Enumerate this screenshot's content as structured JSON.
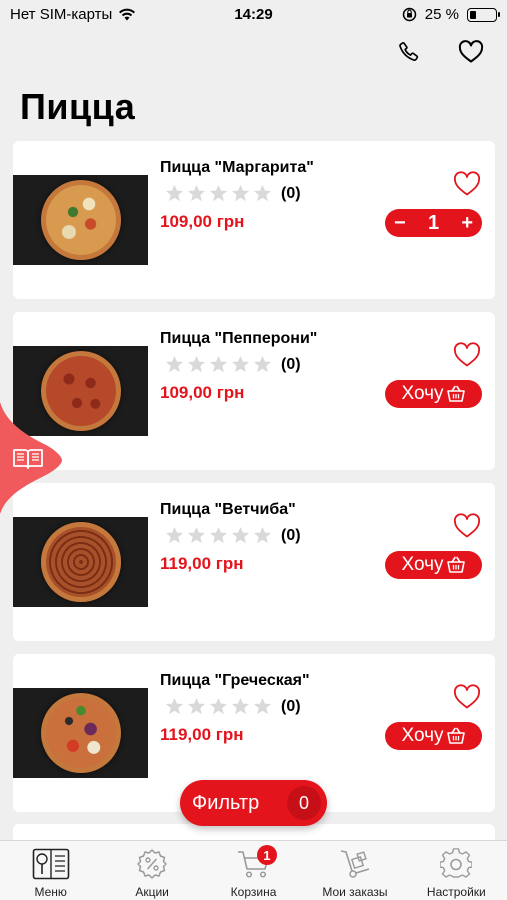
{
  "status_bar": {
    "carrier": "Нет SIM-карты",
    "time": "14:29",
    "battery_percent_text": "25 %",
    "battery_level": 0.25
  },
  "page": {
    "title": "Пицца"
  },
  "products": [
    {
      "name": "Пицца \"Маргарита\"",
      "rating_count": "(0)",
      "price": "109,00 грн",
      "in_cart": true,
      "quantity": "1",
      "stepper_minus": "−",
      "stepper_plus": "+"
    },
    {
      "name": "Пицца \"Пепперони\"",
      "rating_count": "(0)",
      "price": "109,00 грн",
      "in_cart": false,
      "want_label": "Хочу"
    },
    {
      "name": "Пицца \"Ветчиба\"",
      "rating_count": "(0)",
      "price": "119,00 грн",
      "in_cart": false,
      "want_label": "Хочу"
    },
    {
      "name": "Пицца \"Греческая\"",
      "rating_count": "(0)",
      "price": "119,00 грн",
      "in_cart": false,
      "want_label": "Хочу"
    }
  ],
  "filter": {
    "label": "Фильтр",
    "count": "0"
  },
  "tabbar": {
    "items": [
      {
        "label": "Меню",
        "icon": "menu-book-icon"
      },
      {
        "label": "Акции",
        "icon": "discount-icon"
      },
      {
        "label": "Корзина",
        "icon": "cart-icon",
        "badge": "1"
      },
      {
        "label": "Мои заказы",
        "icon": "hand-truck-icon"
      },
      {
        "label": "Настройки",
        "icon": "gear-icon"
      }
    ]
  },
  "colors": {
    "accent": "#e3141c",
    "background": "#efefef",
    "card": "#ffffff",
    "star_empty": "#d9d9d9"
  }
}
